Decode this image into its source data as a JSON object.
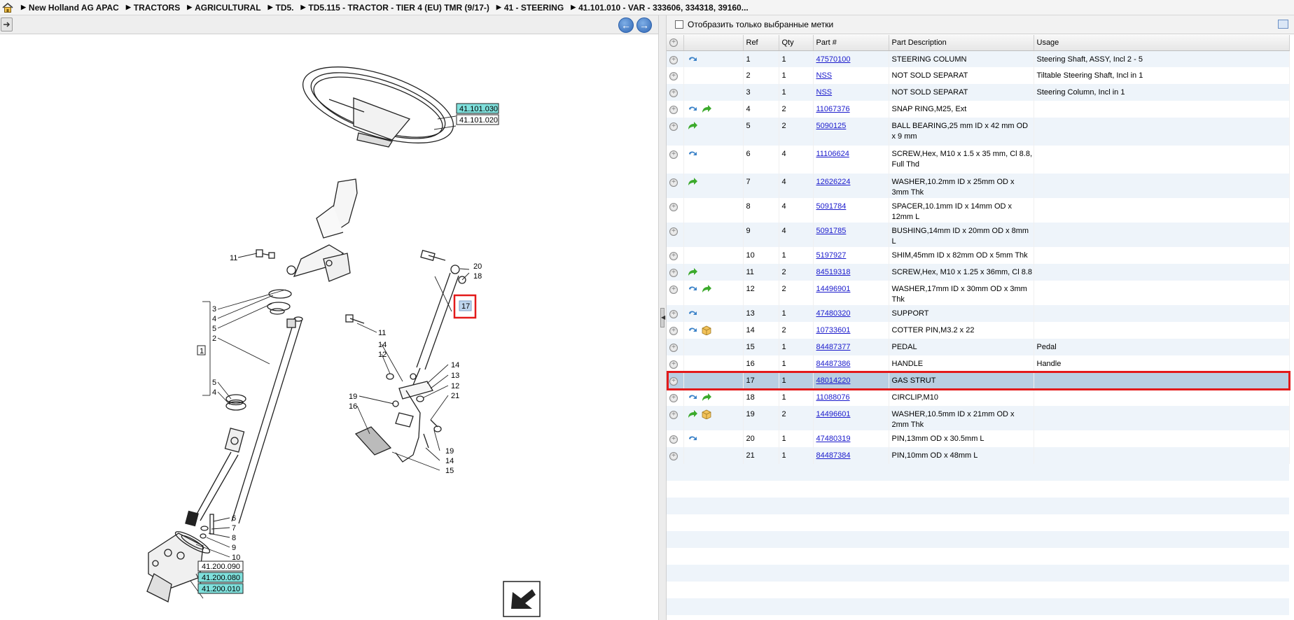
{
  "breadcrumb": [
    "New Holland AG APAC",
    "TRACTORS",
    "AGRICULTURAL",
    "TD5.",
    "TD5.115 - TRACTOR - TIER 4 (EU) TMR (9/17-)",
    "41 - STEERING",
    "41.101.010 - VAR - 333606, 334318, 39160..."
  ],
  "nav": {
    "back": "back-arrow",
    "forward": "forward-arrow"
  },
  "drawing": {
    "refs": {
      "r41101030": "41.101.030",
      "r41101020": "41.101.020",
      "r41200090": "41.200.090",
      "r41200080": "41.200.080",
      "r41200010": "41.200.010"
    },
    "callouts": {
      "c11a": "11",
      "c20": "20",
      "c18": "18",
      "c3": "3",
      "c4a": "4",
      "c5a": "5",
      "c2": "2",
      "c1": "1",
      "c17": "17",
      "c11b": "11",
      "c14a": "14",
      "c12a": "12",
      "c14b": "14",
      "c13": "13",
      "c12b": "12",
      "c21": "21",
      "c19a": "19",
      "c16": "16",
      "c5b": "5",
      "c4b": "4",
      "c19b": "19",
      "c14c": "14",
      "c15": "15",
      "c6": "6",
      "c7": "7",
      "c8": "8",
      "c9": "9",
      "c10": "10"
    }
  },
  "filter": {
    "label": "Отобразить только выбранные метки",
    "checked": false
  },
  "columns": {
    "ref": "Ref",
    "qty": "Qty",
    "part": "Part #",
    "desc": "Part Description",
    "usage": "Usage"
  },
  "rows": [
    {
      "ref": "1",
      "qty": "1",
      "part": "47570100",
      "desc": "STEERING COLUMN",
      "usage": "Steering Shaft, ASSY, Incl 2 - 5",
      "icons": [
        "blue-swap-icon"
      ]
    },
    {
      "ref": "2",
      "qty": "1",
      "part": "NSS",
      "desc": "NOT SOLD SEPARAT",
      "usage": "Tiltable Steering Shaft, Incl in 1",
      "icons": []
    },
    {
      "ref": "3",
      "qty": "1",
      "part": "NSS",
      "desc": "NOT SOLD SEPARAT",
      "usage": "Steering Column, Incl in 1",
      "icons": []
    },
    {
      "ref": "4",
      "qty": "2",
      "part": "11067376",
      "desc": "SNAP RING,M25, Ext",
      "usage": "",
      "icons": [
        "blue-swap-icon",
        "green-arrow-icon"
      ]
    },
    {
      "ref": "5",
      "qty": "2",
      "part": "5090125",
      "desc": "BALL BEARING,25 mm ID x 42 mm OD x 9 mm",
      "usage": "",
      "icons": [
        "green-arrow-icon"
      ]
    },
    {
      "ref": "6",
      "qty": "4",
      "part": "11106624",
      "desc": "SCREW,Hex, M10 x 1.5 x 35 mm, Cl 8.8, Full Thd",
      "usage": "",
      "icons": [
        "blue-swap-icon"
      ]
    },
    {
      "ref": "7",
      "qty": "4",
      "part": "12626224",
      "desc": "WASHER,10.2mm ID x 25mm OD x 3mm Thk",
      "usage": "",
      "icons": [
        "green-arrow-icon"
      ]
    },
    {
      "ref": "8",
      "qty": "4",
      "part": "5091784",
      "desc": "SPACER,10.1mm ID x 14mm OD x 12mm L",
      "usage": "",
      "icons": []
    },
    {
      "ref": "9",
      "qty": "4",
      "part": "5091785",
      "desc": "BUSHING,14mm ID x 20mm OD x 8mm L",
      "usage": "",
      "icons": []
    },
    {
      "ref": "10",
      "qty": "1",
      "part": "5197927",
      "desc": "SHIM,45mm ID x 82mm OD x 5mm Thk",
      "usage": "",
      "icons": []
    },
    {
      "ref": "11",
      "qty": "2",
      "part": "84519318",
      "desc": "SCREW,Hex, M10 x 1.25 x 36mm, Cl 8.8",
      "usage": "",
      "icons": [
        "green-arrow-icon"
      ]
    },
    {
      "ref": "12",
      "qty": "2",
      "part": "14496901",
      "desc": "WASHER,17mm ID x 30mm OD x 3mm Thk",
      "usage": "",
      "icons": [
        "blue-swap-icon",
        "green-arrow-icon"
      ]
    },
    {
      "ref": "13",
      "qty": "1",
      "part": "47480320",
      "desc": "SUPPORT",
      "usage": "",
      "icons": [
        "blue-swap-icon"
      ]
    },
    {
      "ref": "14",
      "qty": "2",
      "part": "10733601",
      "desc": "COTTER PIN,M3.2 x 22",
      "usage": "",
      "icons": [
        "blue-swap-icon",
        "box-icon"
      ]
    },
    {
      "ref": "15",
      "qty": "1",
      "part": "84487377",
      "desc": "PEDAL",
      "usage": "Pedal",
      "icons": []
    },
    {
      "ref": "16",
      "qty": "1",
      "part": "84487386",
      "desc": "HANDLE",
      "usage": "Handle",
      "icons": []
    },
    {
      "ref": "17",
      "qty": "1",
      "part": "48014220",
      "desc": "GAS STRUT",
      "usage": "",
      "icons": [],
      "selected": true
    },
    {
      "ref": "18",
      "qty": "1",
      "part": "11088076",
      "desc": "CIRCLIP,M10",
      "usage": "",
      "icons": [
        "blue-swap-icon",
        "green-arrow-icon"
      ]
    },
    {
      "ref": "19",
      "qty": "2",
      "part": "14496601",
      "desc": "WASHER,10.5mm ID x 21mm OD x 2mm Thk",
      "usage": "",
      "icons": [
        "green-arrow-icon",
        "box-icon"
      ]
    },
    {
      "ref": "20",
      "qty": "1",
      "part": "47480319",
      "desc": "PIN,13mm OD x 30.5mm L",
      "usage": "",
      "icons": [
        "blue-swap-icon"
      ]
    },
    {
      "ref": "21",
      "qty": "1",
      "part": "84487384",
      "desc": "PIN,10mm OD x 48mm L",
      "usage": "",
      "icons": []
    }
  ],
  "colors": {
    "link": "#1a1acc",
    "selected_row": "#b9cfe2",
    "highlight_border": "#e31a1a",
    "callout_fill": "#7fe0dc"
  }
}
